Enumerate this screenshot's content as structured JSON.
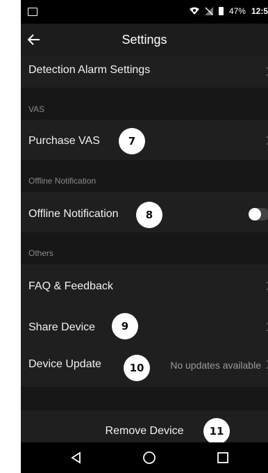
{
  "status_bar": {
    "battery": "47%",
    "time": "12:5"
  },
  "header": {
    "title": "Settings"
  },
  "rows": {
    "detection_alarm": "Detection Alarm Settings",
    "purchase_vas": "Purchase VAS",
    "offline_notification": "Offline Notification",
    "faq_feedback": "FAQ & Feedback",
    "share_device": "Share Device",
    "device_update": "Device Update",
    "device_update_status": "No updates available",
    "remove_device": "Remove Device"
  },
  "sections": {
    "vas": "VAS",
    "offline_notification": "Offline Notification",
    "others": "Others"
  },
  "toggles": {
    "offline_notification_on": false
  },
  "annotations": {
    "b7": "7",
    "b8": "8",
    "b9": "9",
    "b10": "10",
    "b11": "11"
  },
  "colors": {
    "background": "#1a1a1a",
    "row": "#1f1f1f",
    "section": "#171717",
    "badge": "#ffffff"
  }
}
